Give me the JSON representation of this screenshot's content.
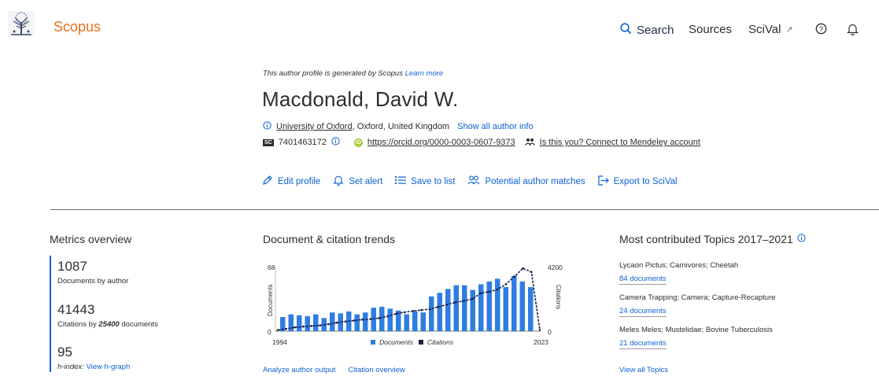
{
  "app": {
    "brand": "Scopus",
    "logo_icon": "elsevier-tree-logo"
  },
  "nav": {
    "search": "Search",
    "sources": "Sources",
    "scival": "SciVal",
    "scival_ext": "↗",
    "help_icon": "?",
    "bell_icon": "bell"
  },
  "profile": {
    "note": "This author profile is generated by Scopus",
    "learn_more": "Learn more",
    "name": "Macdonald, David W.",
    "university": "University of Oxford",
    "location": ", Oxford, United Kingdom",
    "show_all": "Show all author info",
    "sc_badge": "SC",
    "scopus_id": "7401463172",
    "orcid_badge": "iD",
    "orcid_url": "https://orcid.org/0000-0003-0607-9373",
    "mendeley": "Is this you? Connect to Mendeley account"
  },
  "actions": [
    {
      "label": "Edit profile",
      "icon": "✎"
    },
    {
      "label": "Set alert",
      "icon": "🔔"
    },
    {
      "label": "Save to list",
      "icon": "☰"
    },
    {
      "label": "Potential author matches",
      "icon": "👥"
    },
    {
      "label": "Export to SciVal",
      "icon": "⇥"
    }
  ],
  "metrics": {
    "title": "Metrics overview",
    "documents": "1087",
    "documents_label": "Documents by author",
    "citations": "41443",
    "citations_label_pre": "Citations by ",
    "citations_docs": "25400",
    "citations_label_post": " documents",
    "h_index": "95",
    "h_label": "h-index:",
    "h_link": "View h-graph"
  },
  "trends": {
    "title": "Document & citation trends",
    "analyze": "Analyze author output",
    "citation_overview": "Citation overview"
  },
  "chart_data": {
    "type": "bar",
    "x_start_label": "1994",
    "x_end_label": "2023",
    "left_axis_title": "Documents",
    "right_axis_title": "Citations",
    "left_max_label": "68",
    "left_min_label": "0",
    "right_max_label": "4200",
    "right_min_label": "0",
    "ylim_documents": [
      0,
      68
    ],
    "ylim_citations": [
      0,
      4200
    ],
    "legend": [
      {
        "name": "Documents",
        "color": "#2f7de1"
      },
      {
        "name": "Citations",
        "color": "#1b1f4a"
      }
    ],
    "series": [
      {
        "name": "Documents",
        "values": [
          15,
          18,
          17,
          16,
          18,
          14,
          20,
          19,
          21,
          18,
          20,
          25,
          26,
          24,
          22,
          18,
          21,
          20,
          37,
          41,
          45,
          49,
          49,
          44,
          50,
          53,
          56,
          47,
          59,
          53,
          47
        ]
      },
      {
        "name": "Citations",
        "values": [
          80,
          150,
          250,
          300,
          340,
          380,
          460,
          560,
          640,
          700,
          760,
          800,
          860,
          980,
          1150,
          1250,
          1330,
          1390,
          1450,
          1600,
          1750,
          1890,
          1990,
          2120,
          2500,
          2600,
          2750,
          3100,
          3600,
          4150,
          3900,
          80
        ]
      }
    ]
  },
  "topics": {
    "title": "Most contributed Topics 2017–2021",
    "items": [
      {
        "name": "Lycaon Pictus; Carnivores; Cheetah",
        "docs": "84 documents"
      },
      {
        "name": "Camera Trapping; Camera; Capture-Recapture",
        "docs": "24 documents"
      },
      {
        "name": "Meles Meles; Mustelidae; Bovine Tuberculosis",
        "docs": "21 documents"
      }
    ],
    "view_all": "View all Topics"
  }
}
